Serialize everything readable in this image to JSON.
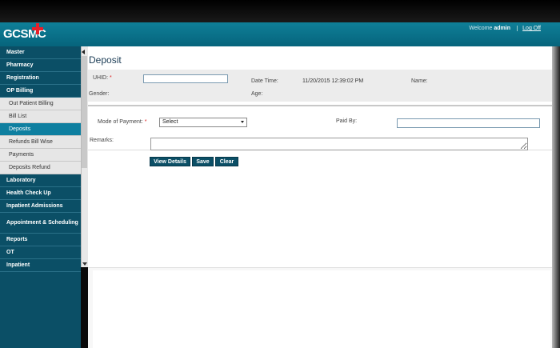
{
  "header": {
    "logo": "GCSMC",
    "welcome_prefix": "Welcome",
    "user": "admin",
    "logoff": "Log Off"
  },
  "sidebar": {
    "items": [
      {
        "label": "Master",
        "type": "main"
      },
      {
        "label": "Pharmacy",
        "type": "main"
      },
      {
        "label": "Registration",
        "type": "main"
      },
      {
        "label": "OP Billing",
        "type": "main"
      },
      {
        "label": "Out Patient Billing",
        "type": "sub"
      },
      {
        "label": "Bill List",
        "type": "sub"
      },
      {
        "label": "Deposits",
        "type": "sub",
        "active": true
      },
      {
        "label": "Refunds Bill Wise",
        "type": "sub"
      },
      {
        "label": "Payments",
        "type": "sub"
      },
      {
        "label": "Deposits Refund",
        "type": "sub"
      },
      {
        "label": "Laboratory",
        "type": "main"
      },
      {
        "label": "Health Check Up",
        "type": "main"
      },
      {
        "label": "Inpatient Admissions",
        "type": "main"
      },
      {
        "label": "Appointment & Scheduling",
        "type": "main",
        "tall": true
      },
      {
        "label": "Reports",
        "type": "main"
      },
      {
        "label": "OT",
        "type": "main"
      },
      {
        "label": "Inpatient",
        "type": "main"
      }
    ]
  },
  "page": {
    "title": "Deposit",
    "uhid_label": "UHID:",
    "uhid_value": "",
    "datetime_label": "Date Time:",
    "datetime_value": "11/20/2015 12:39:02 PM",
    "name_label": "Name:",
    "gender_label": "Gender:",
    "age_label": "Age:",
    "mode_label": "Mode of Payment:",
    "mode_selected": "Select",
    "paidby_label": "Paid By:",
    "paidby_value": "",
    "remarks_label": "Remarks:",
    "remarks_value": "",
    "required_mark": "*"
  },
  "buttons": {
    "view_details": "View Details",
    "save": "Save",
    "clear": "Clear"
  },
  "colors": {
    "header": "#0a7590",
    "sidebar": "#0b4f66",
    "active": "#0e7fa0"
  }
}
